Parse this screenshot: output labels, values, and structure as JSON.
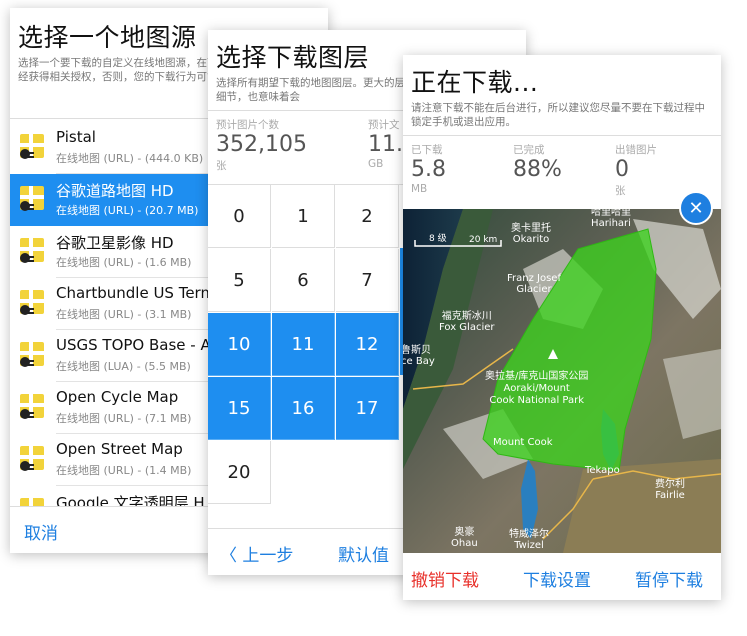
{
  "panel1": {
    "title": "选择一个地图源",
    "description": "选择一个要下载的自定义在线地图源，在下载前务必请确保您已经获得相关授权，否则，您的下载行为可能触犯知",
    "items": [
      {
        "name": "Pistal",
        "sub": "在线地图 (URL) - (444.0 KB)"
      },
      {
        "name": "谷歌道路地图 HD",
        "sub": "在线地图 (URL) - (20.7 MB)"
      },
      {
        "name": "谷歌卫星影像 HD",
        "sub": "在线地图 (URL) - (1.6 MB)"
      },
      {
        "name": "Chartbundle US Term",
        "sub": "在线地图 (URL) - (3.1 MB)"
      },
      {
        "name": "USGS TOPO Base - A",
        "sub": "在线地图 (LUA) - (5.5 MB)"
      },
      {
        "name": "Open Cycle Map",
        "sub": "在线地图 (URL) - (7.1 MB)"
      },
      {
        "name": "Open Street Map",
        "sub": "在线地图 (URL) - (1.4 MB)"
      },
      {
        "name": "Google 文字透明层 H",
        "sub": ""
      }
    ],
    "cancel_label": "取消"
  },
  "panel2": {
    "title": "选择下载图层",
    "description": "选择所有期望下载的地图图层。更大的层级可以放大并显示更多细节，也意味着会",
    "stat1": {
      "label": "预计图片个数",
      "value": "352,105",
      "unit": "张"
    },
    "stat2": {
      "label": "预计文",
      "value": "11.",
      "unit": "GB"
    },
    "levels": [
      "0",
      "1",
      "2",
      "5",
      "6",
      "7",
      "10",
      "11",
      "12",
      "15",
      "16",
      "17",
      "20"
    ],
    "back_label": "上一步",
    "default_label": "默认值"
  },
  "panel3": {
    "title": "正在下载...",
    "description": "请注意下载不能在后台进行，所以建议您尽量不要在下载过程中锁定手机或退出应用。",
    "stat_downloaded": {
      "label": "已下载",
      "value": "5.8",
      "unit": "MB"
    },
    "stat_completed": {
      "label": "已完成",
      "value": "88%"
    },
    "stat_errors": {
      "label": "出错图片",
      "value": "0",
      "unit": "张"
    },
    "close_label": "✕",
    "map": {
      "scale_zoom": "8 级",
      "scale_distance": "20 km",
      "labels": {
        "harihari": [
          "哈里哈里",
          "Harihari"
        ],
        "okarito": [
          "奥卡里托",
          "Okarito"
        ],
        "franz": [
          "Franz Josef",
          "Glacier"
        ],
        "fox": [
          "福克斯冰川",
          "Fox Glacier"
        ],
        "bruce": [
          "鲁斯贝",
          "ce Bay"
        ],
        "park": [
          "奥拉基/库克山国家公园",
          "Aoraki/Mount",
          "Cook National Park"
        ],
        "mountcook": "Mount Cook",
        "tekapo": "Tekapo",
        "fairlie": [
          "费尔利",
          "Fairlie"
        ],
        "ohau": [
          "奥豪",
          "Ohau"
        ],
        "twizel": [
          "特威泽尔",
          "Twizel"
        ]
      }
    },
    "buttons": {
      "cancel": "撤销下载",
      "settings": "下载设置",
      "pause": "暂停下载"
    }
  },
  "colors": {
    "accent": "#1e8ef0",
    "link": "#1e7fe0",
    "danger": "#e8302a",
    "overlay": "#3cd21e"
  }
}
